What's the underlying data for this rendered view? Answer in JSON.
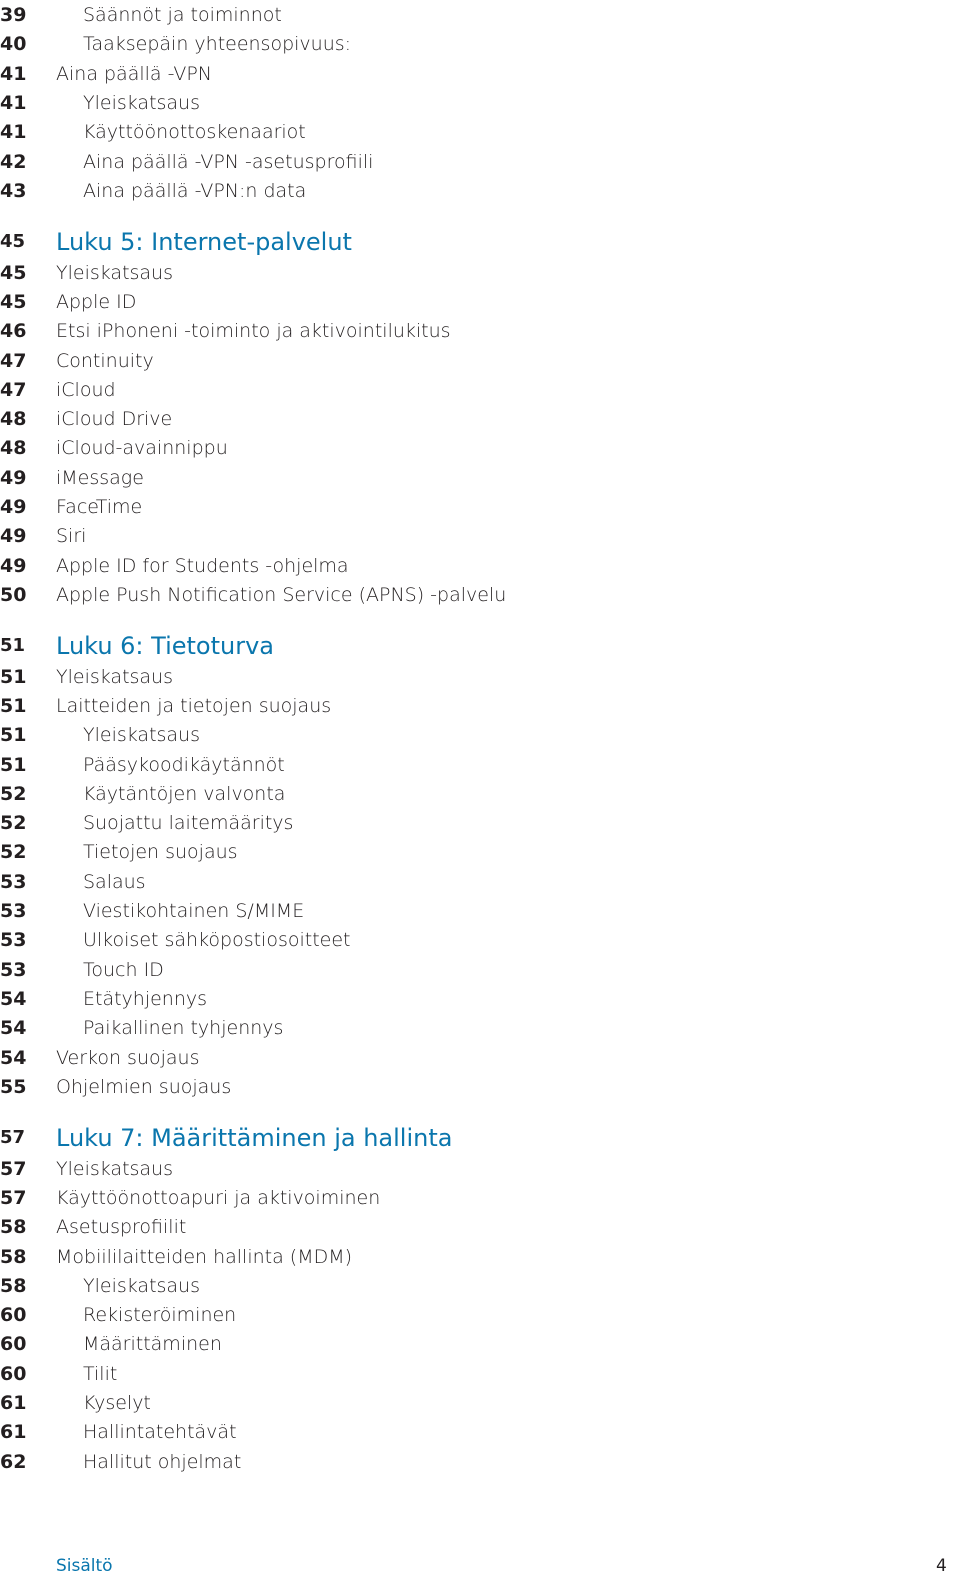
{
  "entries": [
    {
      "page": "39",
      "title": "Säännöt ja toiminnot",
      "level": 2
    },
    {
      "page": "40",
      "title": "Taaksepäin yhteensopivuus:",
      "level": 2
    },
    {
      "page": "41",
      "title": "Aina päällä -VPN",
      "level": 1
    },
    {
      "page": "41",
      "title": "Yleiskatsaus",
      "level": 2
    },
    {
      "page": "41",
      "title": "Käyttöönottoskenaariot",
      "level": 2
    },
    {
      "page": "42",
      "title": "Aina päällä -VPN -asetusprofiili",
      "level": 2
    },
    {
      "page": "43",
      "title": "Aina päällä -VPN:n data",
      "level": 2
    },
    {
      "page": "45",
      "title": "Luku 5: Internet-palvelut",
      "level": 0
    },
    {
      "page": "45",
      "title": "Yleiskatsaus",
      "level": 1
    },
    {
      "page": "45",
      "title": "Apple ID",
      "level": 1
    },
    {
      "page": "46",
      "title": "Etsi iPhoneni -toiminto ja aktivointilukitus",
      "level": 1
    },
    {
      "page": "47",
      "title": "Continuity",
      "level": 1
    },
    {
      "page": "47",
      "title": "iCloud",
      "level": 1
    },
    {
      "page": "48",
      "title": "iCloud Drive",
      "level": 1
    },
    {
      "page": "48",
      "title": "iCloud-avainnippu",
      "level": 1
    },
    {
      "page": "49",
      "title": "iMessage",
      "level": 1
    },
    {
      "page": "49",
      "title": "FaceTime",
      "level": 1
    },
    {
      "page": "49",
      "title": "Siri",
      "level": 1
    },
    {
      "page": "49",
      "title": "Apple ID for Students -ohjelma",
      "level": 1
    },
    {
      "page": "50",
      "title": "Apple Push Notification Service (APNS) -palvelu",
      "level": 1
    },
    {
      "page": "51",
      "title": "Luku 6: Tietoturva",
      "level": 0
    },
    {
      "page": "51",
      "title": "Yleiskatsaus",
      "level": 1
    },
    {
      "page": "51",
      "title": "Laitteiden ja tietojen suojaus",
      "level": 1
    },
    {
      "page": "51",
      "title": "Yleiskatsaus",
      "level": 2
    },
    {
      "page": "51",
      "title": "Pääsykoodikäytännöt",
      "level": 2
    },
    {
      "page": "52",
      "title": "Käytäntöjen valvonta",
      "level": 2
    },
    {
      "page": "52",
      "title": "Suojattu laitemääritys",
      "level": 2
    },
    {
      "page": "52",
      "title": "Tietojen suojaus",
      "level": 2
    },
    {
      "page": "53",
      "title": "Salaus",
      "level": 2
    },
    {
      "page": "53",
      "title": "Viestikohtainen S/MIME",
      "level": 2
    },
    {
      "page": "53",
      "title": "Ulkoiset sähköpostiosoitteet",
      "level": 2
    },
    {
      "page": "53",
      "title": "Touch ID",
      "level": 2
    },
    {
      "page": "54",
      "title": "Etätyhjennys",
      "level": 2
    },
    {
      "page": "54",
      "title": "Paikallinen tyhjennys",
      "level": 2
    },
    {
      "page": "54",
      "title": "Verkon suojaus",
      "level": 1
    },
    {
      "page": "55",
      "title": "Ohjelmien suojaus",
      "level": 1
    },
    {
      "page": "57",
      "title": "Luku 7: Määrittäminen ja hallinta",
      "level": 0
    },
    {
      "page": "57",
      "title": "Yleiskatsaus",
      "level": 1
    },
    {
      "page": "57",
      "title": "Käyttöönottoapuri ja aktivoiminen",
      "level": 1
    },
    {
      "page": "58",
      "title": "Asetusprofiilit",
      "level": 1
    },
    {
      "page": "58",
      "title": "Mobiililaitteiden hallinta (MDM)",
      "level": 1
    },
    {
      "page": "58",
      "title": "Yleiskatsaus",
      "level": 2
    },
    {
      "page": "60",
      "title": "Rekisteröiminen",
      "level": 2
    },
    {
      "page": "60",
      "title": "Määrittäminen",
      "level": 2
    },
    {
      "page": "60",
      "title": "Tilit",
      "level": 2
    },
    {
      "page": "61",
      "title": "Kyselyt",
      "level": 2
    },
    {
      "page": "61",
      "title": "Hallintatehtävät",
      "level": 2
    },
    {
      "page": "62",
      "title": "Hallitut ohjelmat",
      "level": 2
    }
  ],
  "footer": {
    "section": "Sisältö",
    "page_number": "4"
  },
  "colors": {
    "heading": "#0a76ad",
    "text": "#231f20"
  }
}
